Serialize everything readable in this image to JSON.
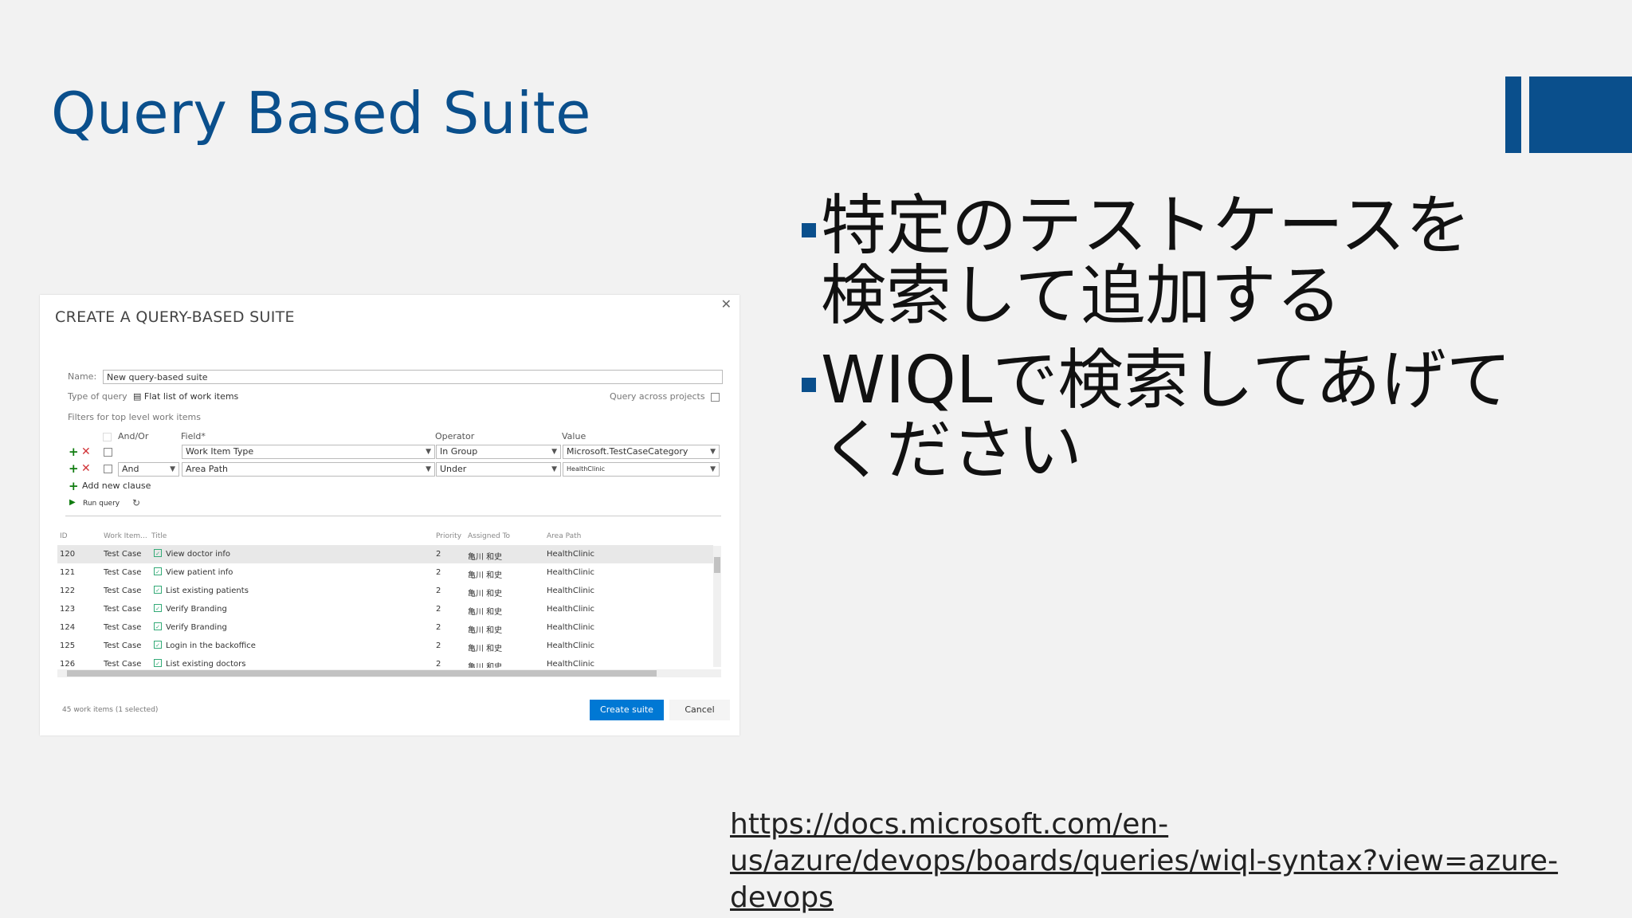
{
  "slide": {
    "title": "Query Based Suite",
    "bullets": [
      "特定のテストケースを\n検索して追加する",
      "WIQLで検索してあげて\nください"
    ],
    "link": "https://docs.microsoft.com/en-us/azure/devops/boards/queries/wiql-syntax?view=azure-devops"
  },
  "dialog": {
    "title": "CREATE A QUERY-BASED SUITE",
    "name_label": "Name:",
    "name_value": "New query-based suite",
    "type_label": "Type of query",
    "type_value": "Flat list of work items",
    "across_label": "Query across projects",
    "filters_label": "Filters for top level work items",
    "columns": {
      "andor": "And/Or",
      "field": "Field*",
      "operator": "Operator",
      "value": "Value"
    },
    "clauses": [
      {
        "andor": "",
        "field": "Work Item Type",
        "operator": "In Group",
        "value": "Microsoft.TestCaseCategory"
      },
      {
        "andor": "And",
        "field": "Area Path",
        "operator": "Under",
        "value": "HealthClinic"
      }
    ],
    "add_clause": "Add new clause",
    "run_query": "Run query",
    "grid_headers": {
      "id": "ID",
      "type": "Work Item...",
      "title": "Title",
      "priority": "Priority",
      "assigned": "Assigned To",
      "area": "Area Path"
    },
    "rows": [
      {
        "id": "120",
        "type": "Test Case",
        "title": "View doctor info",
        "priority": "2",
        "assigned": "亀川 和史",
        "area": "HealthClinic"
      },
      {
        "id": "121",
        "type": "Test Case",
        "title": "View patient info",
        "priority": "2",
        "assigned": "亀川 和史",
        "area": "HealthClinic"
      },
      {
        "id": "122",
        "type": "Test Case",
        "title": "List existing patients",
        "priority": "2",
        "assigned": "亀川 和史",
        "area": "HealthClinic"
      },
      {
        "id": "123",
        "type": "Test Case",
        "title": "Verify Branding",
        "priority": "2",
        "assigned": "亀川 和史",
        "area": "HealthClinic"
      },
      {
        "id": "124",
        "type": "Test Case",
        "title": "Verify Branding",
        "priority": "2",
        "assigned": "亀川 和史",
        "area": "HealthClinic"
      },
      {
        "id": "125",
        "type": "Test Case",
        "title": "Login in the backoffice",
        "priority": "2",
        "assigned": "亀川 和史",
        "area": "HealthClinic"
      },
      {
        "id": "126",
        "type": "Test Case",
        "title": "List existing doctors",
        "priority": "2",
        "assigned": "亀川 和史",
        "area": "HealthClinic"
      }
    ],
    "status": "45 work items (1 selected)",
    "create_button": "Create suite",
    "cancel_button": "Cancel"
  },
  "colors": {
    "accent": "#0a4f8c",
    "primary_button": "#0078d4"
  }
}
